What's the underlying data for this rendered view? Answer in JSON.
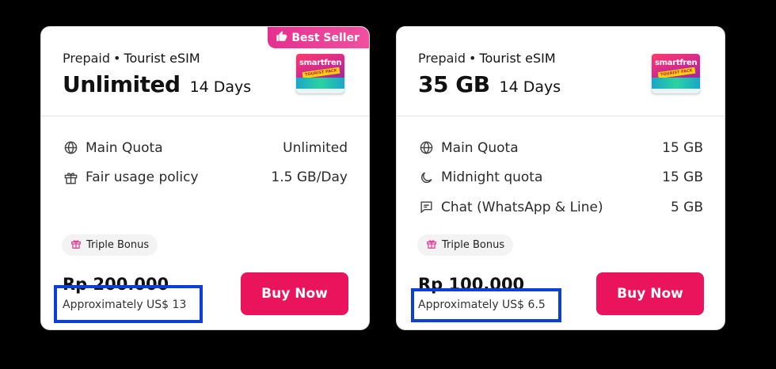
{
  "colors": {
    "accent": "#ea145c",
    "badge": "#e4308f",
    "highlight_box": "#0b3fd6",
    "bonus_icon": "#e4308f"
  },
  "cards": [
    {
      "badge": {
        "icon": "thumbs-up-icon",
        "label": "Best Seller"
      },
      "type": "Prepaid",
      "separator": "•",
      "category": "Tourist eSIM",
      "plan_name": "Unlimited",
      "duration": "14 Days",
      "sim_image": {
        "brand": "smartfren",
        "tag": "TOURIST PACK"
      },
      "features": [
        {
          "icon": "globe-icon",
          "label": "Main Quota",
          "value": "Unlimited"
        },
        {
          "icon": "gift-icon",
          "label": "Fair usage policy",
          "value": "1.5 GB/Day"
        }
      ],
      "bonus": {
        "icon": "gift-icon",
        "label": "Triple Bonus"
      },
      "price": "Rp 200.000",
      "approx": "Approximately US$ 13",
      "buy_label": "Buy Now"
    },
    {
      "badge": null,
      "type": "Prepaid",
      "separator": "•",
      "category": "Tourist eSIM",
      "plan_name": "35 GB",
      "duration": "14 Days",
      "sim_image": {
        "brand": "smartfren",
        "tag": "TOURIST PACK"
      },
      "features": [
        {
          "icon": "globe-icon",
          "label": "Main Quota",
          "value": "15 GB"
        },
        {
          "icon": "moon-icon",
          "label": "Midnight quota",
          "value": "15 GB"
        },
        {
          "icon": "chat-icon",
          "label": "Chat (WhatsApp & Line)",
          "value": "5 GB"
        }
      ],
      "bonus": {
        "icon": "gift-icon",
        "label": "Triple Bonus"
      },
      "price": "Rp 100.000",
      "approx": "Approximately US$ 6.5",
      "buy_label": "Buy Now"
    }
  ]
}
